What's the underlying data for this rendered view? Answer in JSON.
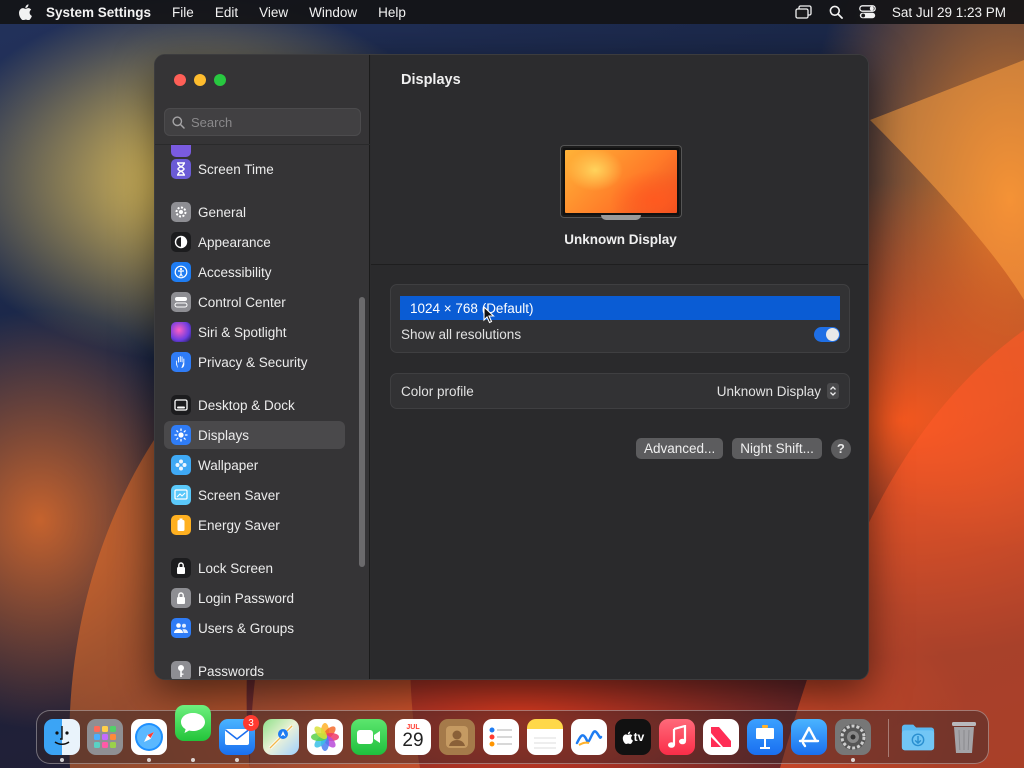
{
  "menubar": {
    "app_name": "System Settings",
    "items": [
      "File",
      "Edit",
      "View",
      "Window",
      "Help"
    ],
    "clock": "Sat Jul 29  1:23 PM"
  },
  "sidebar": {
    "search_placeholder": "Search",
    "items": [
      {
        "label": "Screen Time",
        "icon": "hourglass-icon",
        "color": "#6b5bd6"
      },
      {
        "label": "General",
        "icon": "gear-icon",
        "color": "#8e8e93"
      },
      {
        "label": "Appearance",
        "icon": "appearance-icon",
        "color": "#1c1c1e"
      },
      {
        "label": "Accessibility",
        "icon": "accessibility-icon",
        "color": "#1e7cf2"
      },
      {
        "label": "Control Center",
        "icon": "control-center-icon",
        "color": "#8e8e93"
      },
      {
        "label": "Siri & Spotlight",
        "icon": "siri-icon",
        "color": "#c03fb0"
      },
      {
        "label": "Privacy & Security",
        "icon": "hand-icon",
        "color": "#2f7cf6"
      },
      {
        "label": "Desktop & Dock",
        "icon": "desktop-dock-icon",
        "color": "#1c1c1e"
      },
      {
        "label": "Displays",
        "icon": "sun-icon",
        "color": "#2f7cf6"
      },
      {
        "label": "Wallpaper",
        "icon": "wallpaper-icon",
        "color": "#3fa9f5"
      },
      {
        "label": "Screen Saver",
        "icon": "screen-saver-icon",
        "color": "#5ac8fa"
      },
      {
        "label": "Energy Saver",
        "icon": "battery-icon",
        "color": "#ffb020"
      },
      {
        "label": "Lock Screen",
        "icon": "lock-icon",
        "color": "#1c1c1e"
      },
      {
        "label": "Login Password",
        "icon": "lock-icon",
        "color": "#8e8e93"
      },
      {
        "label": "Users & Groups",
        "icon": "users-icon",
        "color": "#2f7cf6"
      },
      {
        "label": "Passwords",
        "icon": "key-icon",
        "color": "#8e8e93"
      }
    ],
    "selected": "Displays"
  },
  "main": {
    "title": "Displays",
    "display_name": "Unknown Display",
    "resolution": "1024 × 768 (Default)",
    "show_all_label": "Show all resolutions",
    "show_all_on": true,
    "color_profile_label": "Color profile",
    "color_profile_value": "Unknown Display",
    "advanced_button": "Advanced...",
    "night_shift_button": "Night Shift...",
    "help_button": "?"
  },
  "dock": {
    "apps": [
      {
        "name": "Finder",
        "icon": "finder-icon",
        "running": true
      },
      {
        "name": "Launchpad",
        "icon": "launchpad-icon",
        "running": false
      },
      {
        "name": "Safari",
        "icon": "safari-icon",
        "running": true
      },
      {
        "name": "Messages",
        "icon": "messages-icon",
        "running": true
      },
      {
        "name": "Mail",
        "icon": "mail-icon",
        "running": true,
        "badge": "3"
      },
      {
        "name": "Maps",
        "icon": "maps-icon",
        "running": false
      },
      {
        "name": "Photos",
        "icon": "photos-icon",
        "running": false
      },
      {
        "name": "FaceTime",
        "icon": "facetime-icon",
        "running": false
      },
      {
        "name": "Calendar",
        "icon": "calendar-icon",
        "running": false,
        "month": "JUL",
        "day": "29"
      },
      {
        "name": "Contacts",
        "icon": "contacts-icon",
        "running": false
      },
      {
        "name": "Reminders",
        "icon": "reminders-icon",
        "running": false
      },
      {
        "name": "Notes",
        "icon": "notes-icon",
        "running": false
      },
      {
        "name": "Freeform",
        "icon": "freeform-icon",
        "running": false
      },
      {
        "name": "TV",
        "icon": "tv-icon",
        "running": false,
        "label": "tv"
      },
      {
        "name": "Music",
        "icon": "music-icon",
        "running": false
      },
      {
        "name": "News",
        "icon": "news-icon",
        "running": false
      },
      {
        "name": "Keynote",
        "icon": "keynote-icon",
        "running": false
      },
      {
        "name": "App Store",
        "icon": "app-store-icon",
        "running": false
      },
      {
        "name": "System Settings",
        "icon": "system-settings-icon",
        "running": true
      }
    ],
    "extras": [
      {
        "name": "Downloads",
        "icon": "downloads-folder-icon"
      },
      {
        "name": "Trash",
        "icon": "trash-icon"
      }
    ]
  }
}
